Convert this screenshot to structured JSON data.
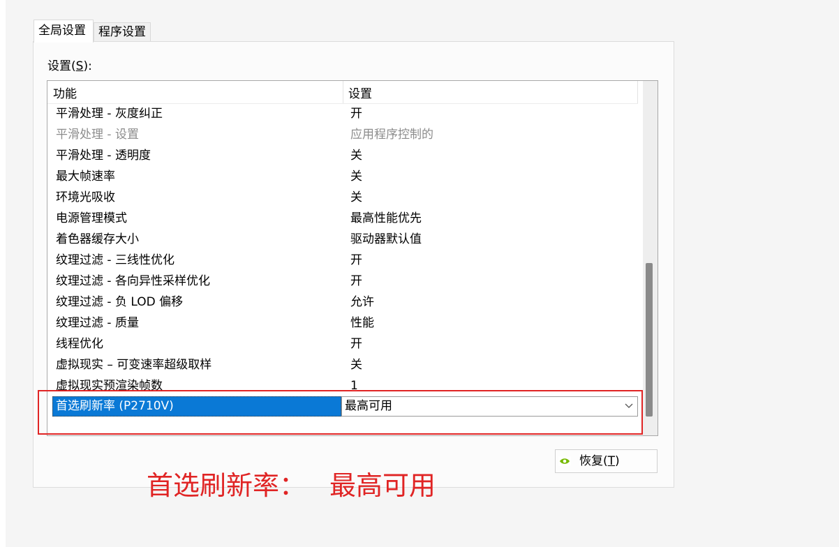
{
  "tabs": [
    {
      "label": "全局设置",
      "active": true
    },
    {
      "label": "程序设置",
      "active": false
    }
  ],
  "settings_label": "设置(",
  "settings_hotkey": "S",
  "settings_label_end": "):",
  "list": {
    "columns": {
      "feature": "功能",
      "setting": "设置"
    },
    "rows": [
      {
        "feature": "平滑处理 - 灰度纠正",
        "value": "开"
      },
      {
        "feature": "平滑处理 - 设置",
        "value": "应用程序控制的",
        "disabled": true
      },
      {
        "feature": "平滑处理 - 透明度",
        "value": "关"
      },
      {
        "feature": "最大帧速率",
        "value": "关"
      },
      {
        "feature": "环境光吸收",
        "value": "关"
      },
      {
        "feature": "电源管理模式",
        "value": "最高性能优先"
      },
      {
        "feature": "着色器缓存大小",
        "value": "驱动器默认值"
      },
      {
        "feature": "纹理过滤 - 三线性优化",
        "value": "开"
      },
      {
        "feature": "纹理过滤 - 各向异性采样优化",
        "value": "开"
      },
      {
        "feature": "纹理过滤 - 负 LOD 偏移",
        "value": "允许"
      },
      {
        "feature": "纹理过滤 - 质量",
        "value": "性能"
      },
      {
        "feature": "线程优化",
        "value": "开"
      },
      {
        "feature": "虚拟现实 – 可变速率超级取样",
        "value": "关"
      },
      {
        "feature": "虚拟现实预渲染帧数",
        "value": "1"
      }
    ],
    "selected": {
      "feature": "首选刷新率 (P2710V)",
      "value": "最高可用"
    }
  },
  "restore_button": {
    "label": "恢复(",
    "hotkey": "T",
    "label_end": ")",
    "icon": "nvidia-logo-icon"
  },
  "annotation": {
    "label": "首选刷新率：",
    "value": "最高可用",
    "color": "#e02424"
  },
  "colors": {
    "selection": "#0a79d6",
    "highlight": "#e02424"
  }
}
